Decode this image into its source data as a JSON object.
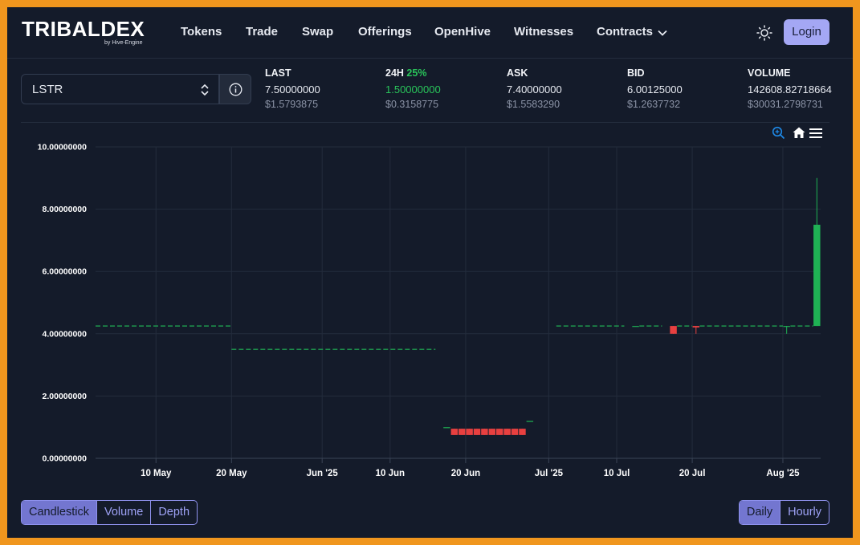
{
  "header": {
    "logo_main": "TRIBALDEX",
    "logo_sub": "by Hive-Engine",
    "nav": [
      "Tokens",
      "Trade",
      "Swap",
      "Offerings",
      "OpenHive",
      "Witnesses",
      "Contracts"
    ],
    "login_label": "Login",
    "theme_icon": "sun-icon"
  },
  "token_select": {
    "value": "LSTR",
    "arrows_icon": "chevron-updown-icon",
    "info_icon": "info-icon"
  },
  "stats": {
    "last": {
      "label": "LAST",
      "value": "7.50000000",
      "usd": "$1.5793875"
    },
    "change": {
      "label": "24H",
      "pct": "25%",
      "value": "1.50000000",
      "usd": "$0.3158775"
    },
    "ask": {
      "label": "ASK",
      "value": "7.40000000",
      "usd": "$1.5583290"
    },
    "bid": {
      "label": "BID",
      "value": "6.00125000",
      "usd": "$1.2637732"
    },
    "volume": {
      "label": "VOLUME",
      "value": "142608.82718664",
      "usd": "$30031.2798731"
    }
  },
  "toolbar_icons": [
    "zoom-in-icon",
    "home-icon",
    "menu-icon"
  ],
  "chart_data": {
    "type": "candlestick",
    "ylim": [
      0,
      10
    ],
    "yticks": [
      "0.00000000",
      "2.00000000",
      "4.00000000",
      "6.00000000",
      "8.00000000",
      "10.00000000"
    ],
    "xlim": [
      "2025-05-02",
      "2025-08-06"
    ],
    "xticks": [
      {
        "date": "2025-05-10",
        "label": "10 May"
      },
      {
        "date": "2025-05-20",
        "label": "20 May"
      },
      {
        "date": "2025-06-01",
        "label": "Jun '25"
      },
      {
        "date": "2025-06-10",
        "label": "10 Jun"
      },
      {
        "date": "2025-06-20",
        "label": "20 Jun"
      },
      {
        "date": "2025-07-01",
        "label": "Jul '25"
      },
      {
        "date": "2025-07-10",
        "label": "10 Jul"
      },
      {
        "date": "2025-07-20",
        "label": "20 Jul"
      },
      {
        "date": "2025-08-01",
        "label": "Aug '25"
      }
    ],
    "segments": [
      {
        "start": "2025-05-02",
        "end": "2025-05-20",
        "open": 4.25,
        "close": 4.25,
        "high": 4.25,
        "low": 4.25
      },
      {
        "start": "2025-05-20",
        "end": "2025-06-16",
        "open": 3.5,
        "close": 3.5,
        "high": 3.5,
        "low": 3.5
      },
      {
        "start": "2025-07-02",
        "end": "2025-07-11",
        "open": 4.25,
        "close": 4.25,
        "high": 4.25,
        "low": 4.25
      },
      {
        "start": "2025-07-13",
        "end": "2025-07-16",
        "open": 4.25,
        "close": 4.25,
        "high": 4.25,
        "low": 4.25
      },
      {
        "start": "2025-07-18",
        "end": "2025-07-20",
        "open": 4.25,
        "close": 4.25,
        "high": 4.25,
        "low": 4.25
      },
      {
        "start": "2025-07-21",
        "end": "2025-08-01",
        "open": 4.25,
        "close": 4.25,
        "high": 4.25,
        "low": 4.25
      },
      {
        "start": "2025-08-02",
        "end": "2025-08-05",
        "open": 4.25,
        "close": 4.25,
        "high": 4.25,
        "low": 4.25
      }
    ],
    "candles": [
      {
        "date": "2025-06-17",
        "open": 1.0,
        "close": 1.0,
        "high": 1.0,
        "low": 1.0
      },
      {
        "date": "2025-06-18",
        "open": 0.95,
        "close": 0.75,
        "high": 0.95,
        "low": 0.75
      },
      {
        "date": "2025-06-19",
        "open": 0.95,
        "close": 0.75,
        "high": 0.95,
        "low": 0.75
      },
      {
        "date": "2025-06-20",
        "open": 0.95,
        "close": 0.75,
        "high": 0.95,
        "low": 0.75
      },
      {
        "date": "2025-06-21",
        "open": 0.95,
        "close": 0.75,
        "high": 0.95,
        "low": 0.75
      },
      {
        "date": "2025-06-22",
        "open": 0.95,
        "close": 0.75,
        "high": 0.95,
        "low": 0.75
      },
      {
        "date": "2025-06-23",
        "open": 0.95,
        "close": 0.75,
        "high": 0.95,
        "low": 0.75
      },
      {
        "date": "2025-06-24",
        "open": 0.95,
        "close": 0.75,
        "high": 0.95,
        "low": 0.75
      },
      {
        "date": "2025-06-25",
        "open": 0.95,
        "close": 0.75,
        "high": 0.95,
        "low": 0.75
      },
      {
        "date": "2025-06-26",
        "open": 0.95,
        "close": 0.75,
        "high": 0.95,
        "low": 0.75
      },
      {
        "date": "2025-06-27",
        "open": 0.95,
        "close": 0.75,
        "high": 0.95,
        "low": 0.75
      },
      {
        "date": "2025-06-28",
        "open": 1.2,
        "close": 1.2,
        "high": 1.2,
        "low": 1.2
      },
      {
        "date": "2025-07-12",
        "open": 4.25,
        "close": 4.25,
        "high": 4.25,
        "low": 4.25
      },
      {
        "date": "2025-07-17",
        "open": 4.25,
        "close": 4.0,
        "high": 4.25,
        "low": 4.0
      },
      {
        "date": "2025-07-20",
        "open": 4.25,
        "close": 4.2,
        "high": 4.25,
        "low": 4.0
      },
      {
        "date": "2025-08-01",
        "open": 4.25,
        "close": 4.25,
        "high": 4.25,
        "low": 4.0
      },
      {
        "date": "2025-08-05",
        "open": 4.25,
        "close": 7.5,
        "high": 9.0,
        "low": 4.25
      }
    ]
  },
  "chart_types": [
    "Candlestick",
    "Volume",
    "Depth"
  ],
  "chart_types_active": "Candlestick",
  "intervals": [
    "Daily",
    "Hourly"
  ],
  "intervals_active": "Daily",
  "colors": {
    "up": "#1fb254",
    "down": "#e84040",
    "accent": "#a4a7f4",
    "border": "#f0961e"
  }
}
